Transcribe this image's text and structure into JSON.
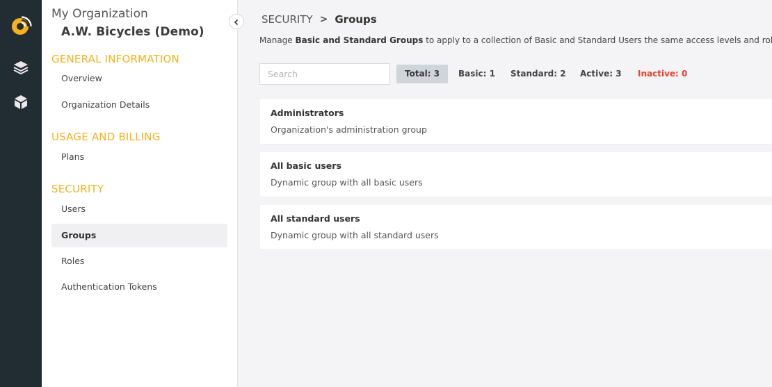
{
  "rail": {
    "logo_icon": "logo-icon",
    "items": [
      {
        "icon": "layers-icon"
      },
      {
        "icon": "cube-icon"
      }
    ],
    "colors": {
      "background": "#222c33",
      "accent": "#f5b21c",
      "icon": "#e8e8ea"
    }
  },
  "sidebar": {
    "org_label": "My Organization",
    "org_name": "A.W. Bicycles (Demo)",
    "sections": [
      {
        "title": "GENERAL INFORMATION",
        "items": [
          {
            "label": "Overview"
          },
          {
            "label": "Organization Details"
          }
        ]
      },
      {
        "title": "USAGE AND BILLING",
        "items": [
          {
            "label": "Plans"
          }
        ]
      },
      {
        "title": "SECURITY",
        "items": [
          {
            "label": "Users"
          },
          {
            "label": "Groups",
            "active": true
          },
          {
            "label": "Roles"
          },
          {
            "label": "Authentication Tokens"
          }
        ]
      }
    ],
    "collapse_icon": "chevron-left-icon"
  },
  "main": {
    "breadcrumb": {
      "parent": "SECURITY",
      "separator": ">",
      "current": "Groups"
    },
    "description": {
      "prefix": "Manage ",
      "bold": "Basic and Standard Groups",
      "suffix": " to apply to a collection of Basic and Standard Users the same access levels and roles."
    },
    "search": {
      "placeholder": "Search",
      "value": ""
    },
    "filters": {
      "total": "Total: 3",
      "basic": "Basic: 1",
      "standard": "Standard: 2",
      "active": "Active: 3",
      "inactive": "Inactive: 0"
    },
    "groups": [
      {
        "name": "Administrators",
        "description": "Organization's administration group"
      },
      {
        "name": "All basic users",
        "description": "Dynamic group with all basic users"
      },
      {
        "name": "All standard users",
        "description": "Dynamic group with all standard users"
      }
    ]
  },
  "colors": {
    "section_heading": "#f5b21c",
    "inactive_text": "#e8412c",
    "active_filter_bg": "#cfd5db",
    "page_bg": "#f4f4f6"
  }
}
